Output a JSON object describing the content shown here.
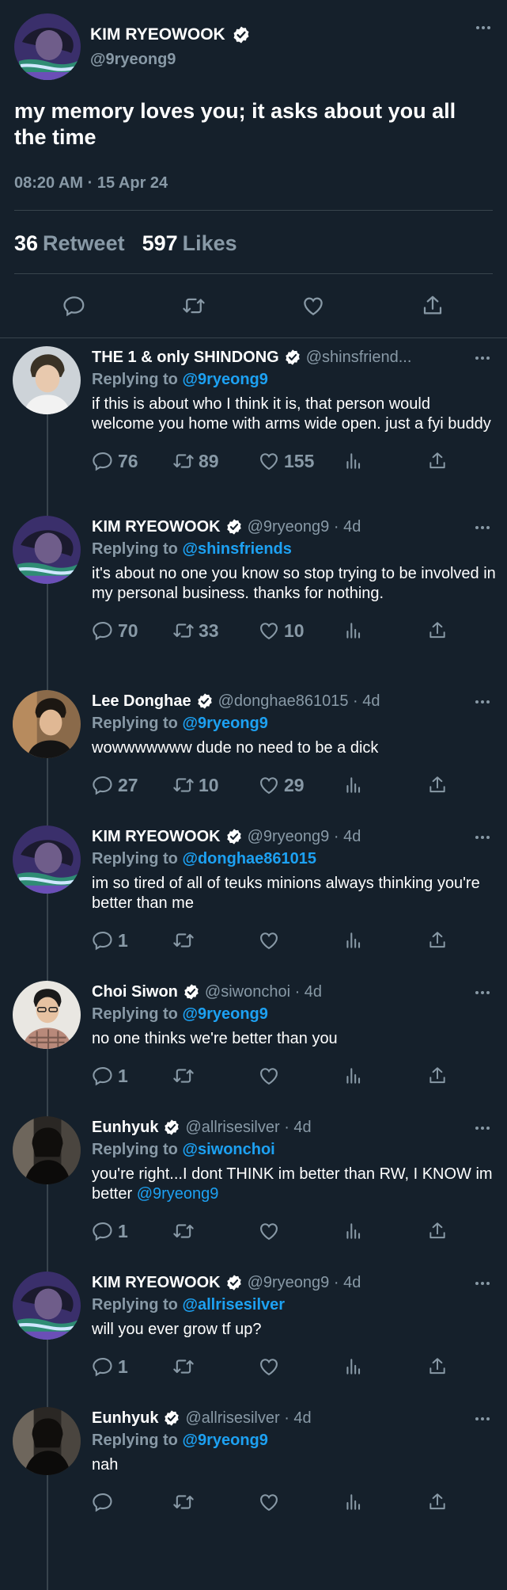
{
  "main_tweet": {
    "name": "KIM RYEOWOOK",
    "handle": "@9ryeong9",
    "text": "my memory loves you; it asks about you all the time",
    "time": "08:20 AM · 15 Apr 24",
    "retweets_count": "36",
    "retweets_label": "Retweet",
    "likes_count": "597",
    "likes_label": "Likes"
  },
  "replies": [
    {
      "name": "THE 1 & only SHINDONG",
      "handle": "@shinsfriend...",
      "replying_prefix": "Replying to",
      "replying_to": "@9ryeong9",
      "text": "if this is about who I think it is, that person would welcome you home with arms wide open. just a fyi buddy",
      "replies": "76",
      "retweets": "89",
      "likes": "155"
    },
    {
      "name": "KIM RYEOWOOK",
      "handle": "@9ryeong9 · 4d",
      "replying_prefix": "Replying to",
      "replying_to": "@shinsfriends",
      "text": "it's about no one you know so stop trying to be involved in my personal business. thanks for nothing.",
      "replies": "70",
      "retweets": "33",
      "likes": "10"
    },
    {
      "name": "Lee Donghae",
      "handle": "@donghae861015 · 4d",
      "replying_prefix": "Replying to",
      "replying_to": "@9ryeong9",
      "text": "wowwwwwww dude no need to be a dick",
      "replies": "27",
      "retweets": "10",
      "likes": "29"
    },
    {
      "name": "KIM RYEOWOOK",
      "handle": "@9ryeong9 · 4d",
      "replying_prefix": "Replying to",
      "replying_to": "@donghae861015",
      "text": "im so tired of all of teuks minions always thinking you're better than me",
      "replies": "1",
      "retweets": "",
      "likes": ""
    },
    {
      "name": "Choi Siwon",
      "handle": "@siwonchoi · 4d",
      "replying_prefix": "Replying to",
      "replying_to": "@9ryeong9",
      "text": "no one thinks we're better than you",
      "replies": "1",
      "retweets": "",
      "likes": ""
    },
    {
      "name": "Eunhyuk",
      "handle": "@allrisesilver · 4d",
      "replying_prefix": "Replying to",
      "replying_to": "@siwonchoi",
      "text": "you're right...I dont THINK im better than RW, I KNOW im better",
      "text_mention": "@9ryeong9",
      "replies": "1",
      "retweets": "",
      "likes": ""
    },
    {
      "name": "KIM RYEOWOOK",
      "handle": "@9ryeong9 · 4d",
      "replying_prefix": "Replying to",
      "replying_to": "@allrisesilver",
      "text": "will you ever grow tf up?",
      "replies": "1",
      "retweets": "",
      "likes": ""
    },
    {
      "name": "Eunhyuk",
      "handle": "@allrisesilver · 4d",
      "replying_prefix": "Replying to",
      "replying_to": "@9ryeong9",
      "text": "nah",
      "replies": "",
      "retweets": "",
      "likes": ""
    }
  ],
  "colors": {
    "background": "#15202b",
    "link": "#1da1f2",
    "secondary_text": "#8899a6",
    "border": "#38444d"
  }
}
